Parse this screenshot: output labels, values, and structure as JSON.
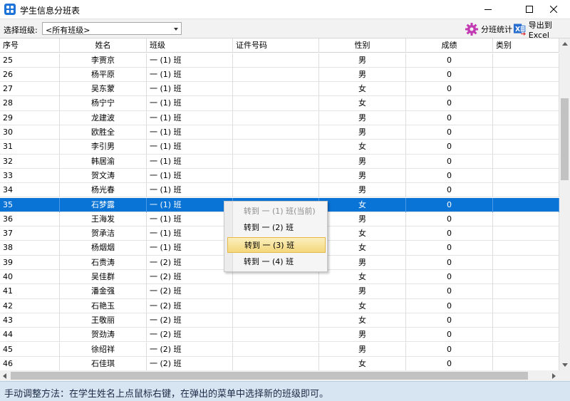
{
  "window": {
    "title": "学生信息分班表"
  },
  "toolbar": {
    "class_label": "选择班级:",
    "class_select_value": "<所有班级>",
    "stats_button": "分班统计",
    "export_button": "导出到Excel"
  },
  "grid": {
    "columns": [
      "序号",
      "姓名",
      "班级",
      "证件号码",
      "性别",
      "成绩",
      "类别"
    ],
    "rows": [
      [
        "25",
        "李贾京",
        "一 (1) 班",
        "",
        "男",
        "0",
        ""
      ],
      [
        "26",
        "杨平原",
        "一 (1) 班",
        "",
        "男",
        "0",
        ""
      ],
      [
        "27",
        "吴东蒙",
        "一 (1) 班",
        "",
        "女",
        "0",
        ""
      ],
      [
        "28",
        "杨宁宁",
        "一 (1) 班",
        "",
        "女",
        "0",
        ""
      ],
      [
        "29",
        "龙建波",
        "一 (1) 班",
        "",
        "男",
        "0",
        ""
      ],
      [
        "30",
        "欧胜全",
        "一 (1) 班",
        "",
        "男",
        "0",
        ""
      ],
      [
        "31",
        "李引男",
        "一 (1) 班",
        "",
        "女",
        "0",
        ""
      ],
      [
        "32",
        "韩居渝",
        "一 (1) 班",
        "",
        "男",
        "0",
        ""
      ],
      [
        "33",
        "贺文涛",
        "一 (1) 班",
        "",
        "男",
        "0",
        ""
      ],
      [
        "34",
        "杨光春",
        "一 (1) 班",
        "",
        "男",
        "0",
        ""
      ],
      [
        "35",
        "石梦露",
        "一 (1) 班",
        "",
        "女",
        "0",
        ""
      ],
      [
        "36",
        "王海发",
        "一 (1) 班",
        "",
        "男",
        "0",
        ""
      ],
      [
        "37",
        "贺承洁",
        "一 (1) 班",
        "",
        "女",
        "0",
        ""
      ],
      [
        "38",
        "杨烟烟",
        "一 (1) 班",
        "",
        "女",
        "0",
        ""
      ],
      [
        "39",
        "石贵涛",
        "一 (2) 班",
        "",
        "男",
        "0",
        ""
      ],
      [
        "40",
        "吴佳群",
        "一 (2) 班",
        "",
        "女",
        "0",
        ""
      ],
      [
        "41",
        "潘金强",
        "一 (2) 班",
        "",
        "男",
        "0",
        ""
      ],
      [
        "42",
        "石艳玉",
        "一 (2) 班",
        "",
        "女",
        "0",
        ""
      ],
      [
        "43",
        "王敬丽",
        "一 (2) 班",
        "",
        "女",
        "0",
        ""
      ],
      [
        "44",
        "贺劲涛",
        "一 (2) 班",
        "",
        "男",
        "0",
        ""
      ],
      [
        "45",
        "徐绍祥",
        "一 (2) 班",
        "",
        "男",
        "0",
        ""
      ],
      [
        "46",
        "石佳琪",
        "一 (2) 班",
        "",
        "女",
        "0",
        ""
      ]
    ],
    "selected_row": 10
  },
  "context_menu": {
    "items": [
      {
        "label": "转到 一 (1) 班(当前)",
        "disabled": true
      },
      {
        "label": "转到 一 (2) 班",
        "disabled": false
      },
      {
        "label": "转到 一 (3) 班",
        "disabled": false,
        "hover": true
      },
      {
        "label": "转到 一 (4) 班",
        "disabled": false
      }
    ]
  },
  "statusbar": {
    "text": "手动调整方法：在学生姓名上点鼠标右键，在弹出的菜单中选择新的班级即可。"
  },
  "colors": {
    "selection": "#0a73d6",
    "statusbar": "#d7e4f2",
    "menu_hover": "#f6e49a",
    "gear_icon": "#c23bb3",
    "excel_icon": "#2a6fcf"
  }
}
